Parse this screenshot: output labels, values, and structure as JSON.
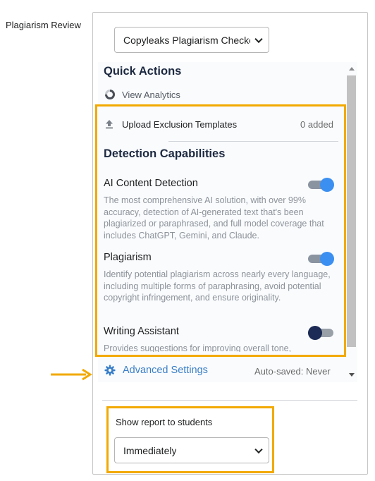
{
  "field_label": "Plagiarism Review",
  "engine_select": {
    "value": "Copyleaks Plagiarism Checker"
  },
  "quick_actions": {
    "title": "Quick Actions",
    "view_analytics": "View Analytics"
  },
  "upload": {
    "label": "Upload Exclusion Templates",
    "count": "0 added"
  },
  "detection": {
    "title": "Detection Capabilities",
    "capabilities": [
      {
        "title": "AI Content Detection",
        "description": "The most comprehensive AI solution, with over 99% accuracy, detection of AI-generated text that's been plagiarized or paraphrased, and full model coverage that includes ChatGPT, Gemini, and Claude.",
        "enabled": true
      },
      {
        "title": "Plagiarism",
        "description": "Identify potential plagiarism across nearly every language, including multiple forms of paraphrasing, avoid potential copyright infringement, and ensure originality.",
        "enabled": true
      },
      {
        "title": "Writing Assistant",
        "description": "Provides suggestions for improving overall tone,",
        "enabled": false
      }
    ]
  },
  "advanced": {
    "label": "Advanced Settings",
    "autosave": "Auto-saved: Never"
  },
  "show_report": {
    "label": "Show report to students",
    "value": "Immediately"
  },
  "colors": {
    "highlight": "#f2a900",
    "toggle_on": "#3b8ff1",
    "toggle_off": "#1c2b55",
    "link": "#3a7ec7",
    "heading": "#1d2940"
  },
  "icons": {
    "view_analytics": "donut-chart-icon",
    "upload": "upload-icon",
    "advanced": "gear-icon",
    "callout": "arrow-right-icon"
  }
}
